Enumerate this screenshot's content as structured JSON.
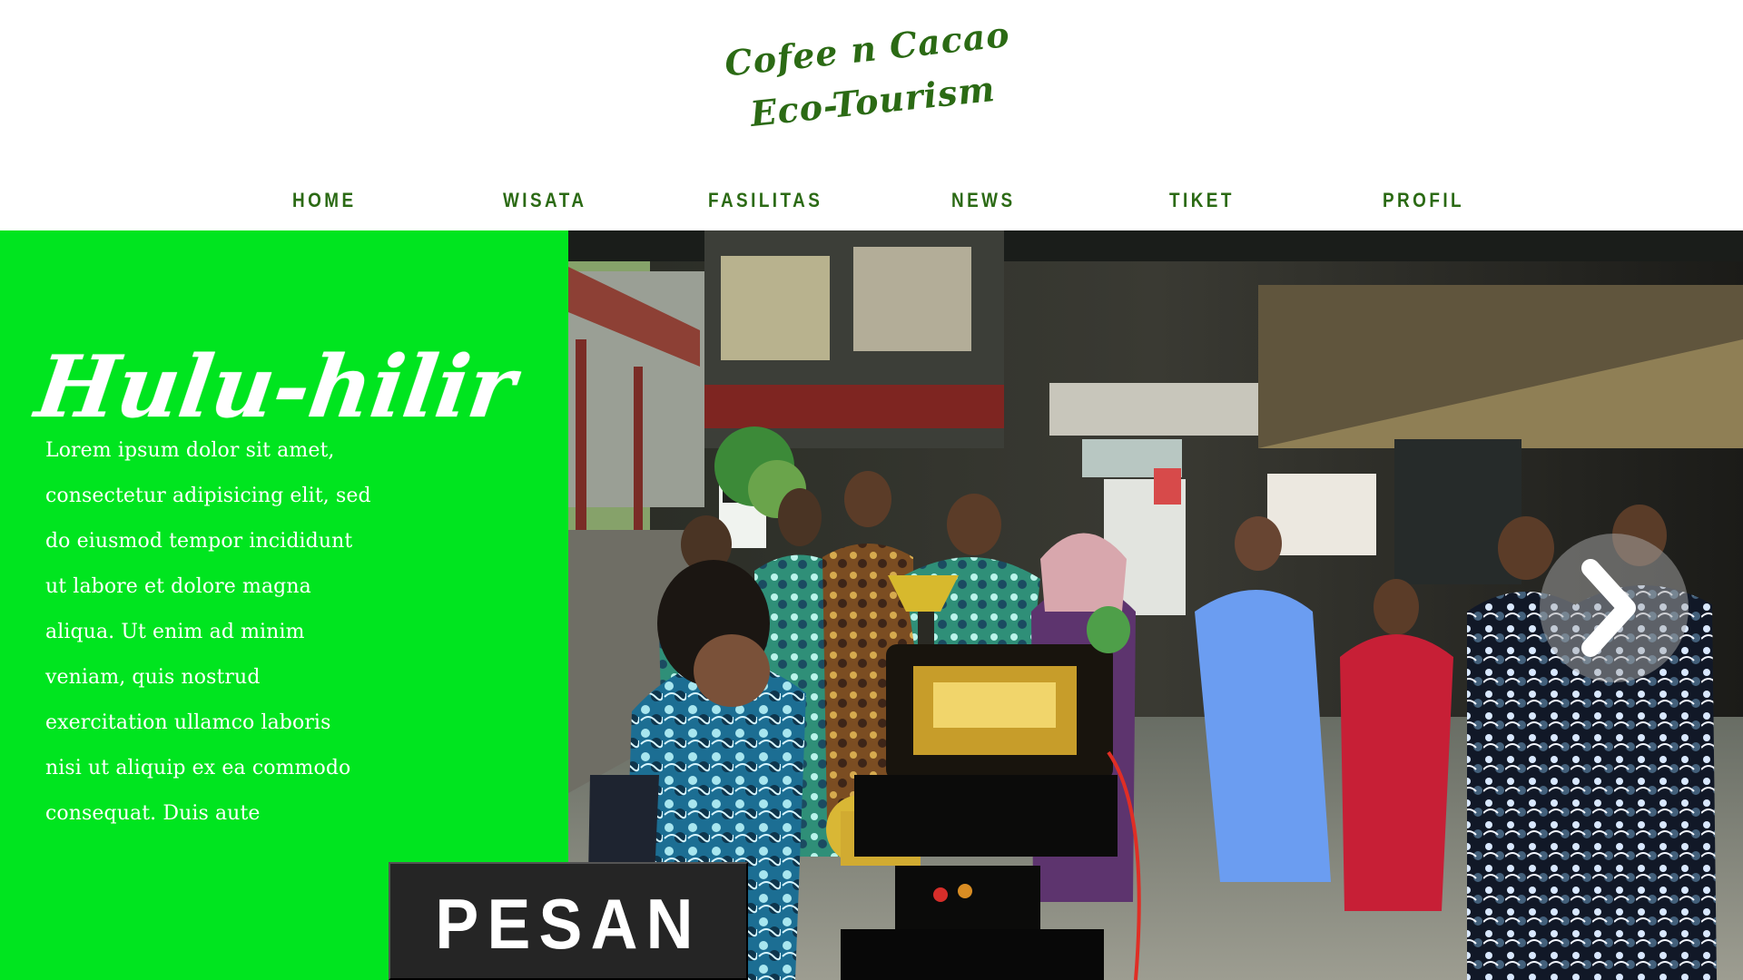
{
  "logo": {
    "line1": "Cofee n Cacao",
    "line2": "Eco-Tourism"
  },
  "nav": {
    "items": [
      {
        "label": "HOME"
      },
      {
        "label": "WISATA"
      },
      {
        "label": "FASILITAS"
      },
      {
        "label": "NEWS"
      },
      {
        "label": "TIKET"
      },
      {
        "label": "PROFIL"
      }
    ]
  },
  "hero": {
    "title": "Hulu-hilir",
    "paragraph": "Lorem ipsum dolor sit amet, consectetur adipisicing elit, sed do eiusmod tempor incididunt ut labore et dolore magna aliqua. Ut enim ad minim veniam, quis nostrud exercitation ullamco laboris nisi ut aliquip ex ea commodo consequat. Duis aute",
    "cta_label": "PESAN"
  },
  "icons": {
    "next": "chevron-right-icon"
  },
  "colors": {
    "brand_green": "#2b6a14",
    "hero_green": "#00e51f",
    "button_dark": "#252525",
    "white": "#ffffff"
  }
}
